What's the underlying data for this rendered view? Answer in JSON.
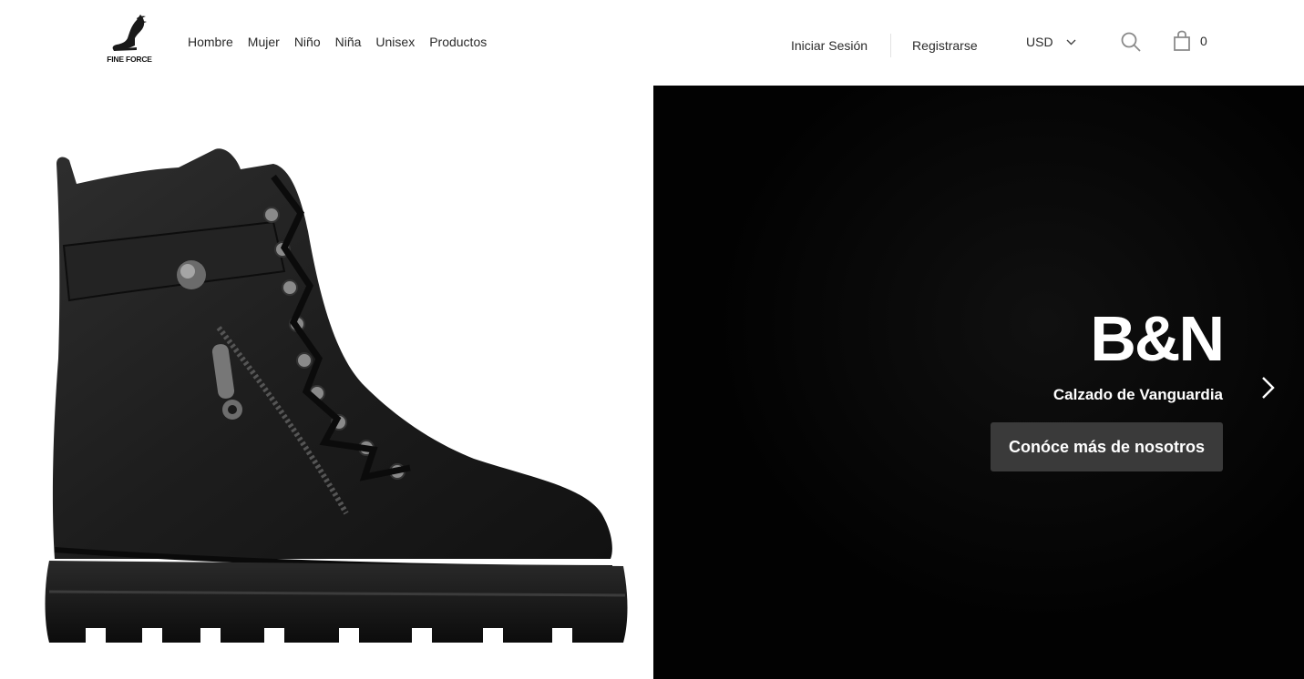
{
  "header": {
    "logo_text": "FINE FORCE",
    "nav": [
      "Hombre",
      "Mujer",
      "Niño",
      "Niña",
      "Unisex",
      "Productos"
    ],
    "login_label": "Iniciar Sesión",
    "register_label": "Registrarse",
    "currency": "USD",
    "cart_count": "0"
  },
  "hero": {
    "title": "B&N",
    "subtitle": "Calzado de Vanguardia",
    "cta_label": "Conóce más de nosotros"
  },
  "colors": {
    "hero_background": "#020202",
    "cta_background": "#3a3a3a",
    "text": "#2b2b2b"
  }
}
